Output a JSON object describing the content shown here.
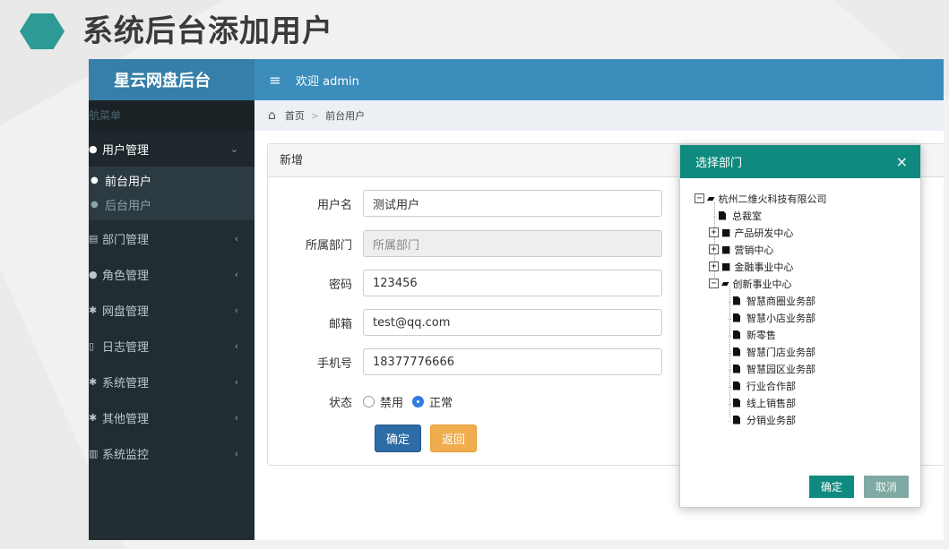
{
  "slide": {
    "title": "系统后台添加用户"
  },
  "app": {
    "brand": "星云网盘后台",
    "welcome": "欢迎 admin",
    "nav_header": "航菜单",
    "menu": [
      {
        "label": "用户管理",
        "icon": "user-icon",
        "arrow": "⌄",
        "open": true
      },
      {
        "label": "部门管理",
        "icon": "list-icon",
        "arrow": "‹"
      },
      {
        "label": "角色管理",
        "icon": "user-icon",
        "arrow": "‹"
      },
      {
        "label": "网盘管理",
        "icon": "gear-icon",
        "arrow": "‹"
      },
      {
        "label": "日志管理",
        "icon": "file-icon",
        "arrow": "‹"
      },
      {
        "label": "系统管理",
        "icon": "gear-icon",
        "arrow": "‹"
      },
      {
        "label": "其他管理",
        "icon": "gear-icon",
        "arrow": "‹"
      },
      {
        "label": "系统监控",
        "icon": "chart-icon",
        "arrow": "‹"
      }
    ],
    "submenu": [
      {
        "label": "前台用户",
        "active": true
      },
      {
        "label": "后台用户",
        "active": false
      }
    ],
    "breadcrumb": {
      "home": "首页",
      "sep": ">",
      "current": "前台用户"
    }
  },
  "form": {
    "panel_title": "新增",
    "username": {
      "label": "用户名",
      "value": "测试用户"
    },
    "dept": {
      "label": "所属部门",
      "placeholder": "所属部门"
    },
    "password": {
      "label": "密码",
      "value": "123456"
    },
    "email": {
      "label": "邮箱",
      "value": "test@qq.com"
    },
    "phone": {
      "label": "手机号",
      "value": "18377776666"
    },
    "status": {
      "label": "状态",
      "options": [
        "禁用",
        "正常"
      ],
      "selected": "正常"
    },
    "submit": "确定",
    "back": "返回"
  },
  "modal": {
    "title": "选择部门",
    "close": "×",
    "tree": [
      {
        "label": "杭州二维火科技有限公司",
        "depth": 0,
        "type": "root",
        "toggle": "−"
      },
      {
        "label": "总裁室",
        "depth": 1,
        "type": "leaf"
      },
      {
        "label": "产品研发中心",
        "depth": 1,
        "type": "folder",
        "toggle": "+"
      },
      {
        "label": "营销中心",
        "depth": 1,
        "type": "folder",
        "toggle": "+"
      },
      {
        "label": "金融事业中心",
        "depth": 1,
        "type": "folder",
        "toggle": "+"
      },
      {
        "label": "创新事业中心",
        "depth": 1,
        "type": "open",
        "toggle": "−"
      },
      {
        "label": "智慧商圈业务部",
        "depth": 2,
        "type": "leaf"
      },
      {
        "label": "智慧小店业务部",
        "depth": 2,
        "type": "leaf"
      },
      {
        "label": "新零售",
        "depth": 2,
        "type": "leaf"
      },
      {
        "label": "智慧门店业务部",
        "depth": 2,
        "type": "leaf"
      },
      {
        "label": "智慧园区业务部",
        "depth": 2,
        "type": "leaf"
      },
      {
        "label": "行业合作部",
        "depth": 2,
        "type": "leaf"
      },
      {
        "label": "线上销售部",
        "depth": 2,
        "type": "leaf"
      },
      {
        "label": "分销业务部",
        "depth": 2,
        "type": "leaf"
      }
    ],
    "ok": "确定",
    "cancel": "取消"
  },
  "colors": {
    "teal": "#0f8a7e",
    "brand_blue": "#367fa9",
    "topbar_blue": "#3c8dbc",
    "sidebar": "#222d32"
  }
}
